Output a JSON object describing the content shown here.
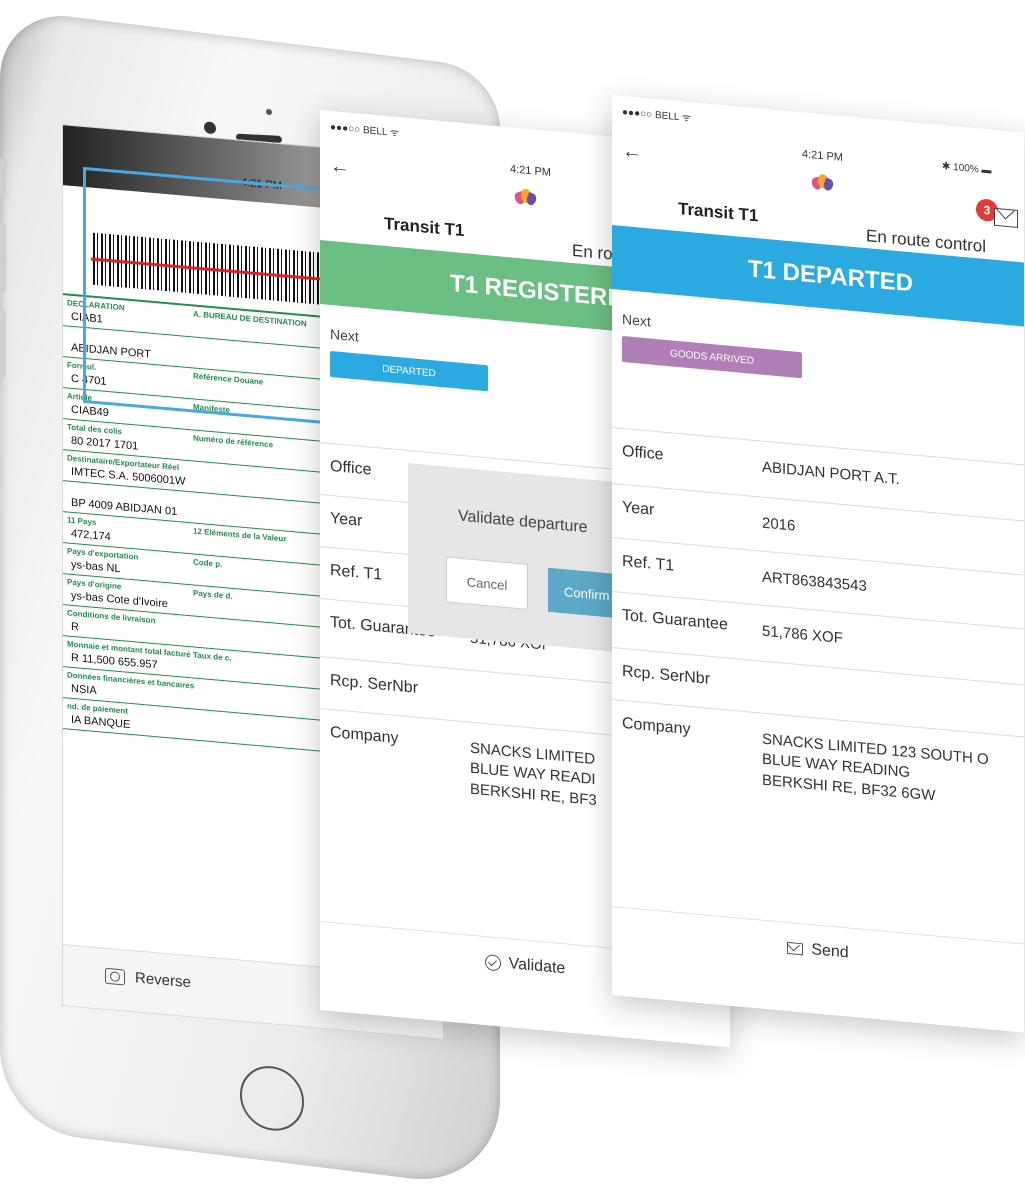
{
  "colors": {
    "registered_green": "#6cbf84",
    "departed_blue": "#2ba9e1",
    "next_departed_blue": "#2ba9e1",
    "goods_arrived_purple": "#b07fb8",
    "confirm_blue": "#5ba8c8",
    "badge_red": "#e53935"
  },
  "scan_screen": {
    "time": "4:21 PM",
    "doc_rows": [
      {
        "label": "DECLARATION",
        "label2": "A. BUREAU DE DESTINATION",
        "value": "CIAB1"
      },
      {
        "label": "",
        "label2": "",
        "value": "ABIDJAN PORT"
      },
      {
        "label": "Formul.",
        "label2": "Référence Douane",
        "value": "C   4701"
      },
      {
        "label": "Article",
        "label2": "Manifeste",
        "value": "CIAB49"
      },
      {
        "label": "Total des colis",
        "label2": "Numéro de référence",
        "value": "80   2017   1701"
      },
      {
        "label": "Destinataire/Exportateur Réel",
        "label2": "",
        "value": "IMTEC S.A.   5006001W"
      },
      {
        "label": "",
        "label2": "",
        "value": "BP 4009 ABIDJAN 01"
      },
      {
        "label": "11 Pays",
        "label2": "12 Eléments de la Valeur",
        "value": "472,174"
      },
      {
        "label": "Pays d'exportation",
        "label2": "Code p.",
        "value": "ys-bas   NL"
      },
      {
        "label": "Pays d'origine",
        "label2": "Pays de d.",
        "value": "ys-bas   Cote d'Ivoire"
      },
      {
        "label": "Conditions de livraison",
        "label2": "",
        "value": "R"
      },
      {
        "label": "Monnaie et montant total facturé",
        "label2": "Taux de c.",
        "value": "R   11,500   655.957"
      },
      {
        "label": "Données financières et bancaires",
        "label2": "",
        "value": "NSIA"
      },
      {
        "label": "nd. de paiement",
        "label2": "",
        "value": "IA BANQUE"
      }
    ],
    "reverse_label": "Reverse"
  },
  "screen1": {
    "carrier": "●●●○○ BELL ᯤ",
    "time": "4:21 PM",
    "transit_title": "Transit T1",
    "control_label": "En route control",
    "status_banner": "T1 REGISTERED",
    "next_label": "Next",
    "next_action": "DEPARTED",
    "details": [
      {
        "key": "Office",
        "value": ""
      },
      {
        "key": "Year",
        "value": ""
      },
      {
        "key": "Ref. T1",
        "value": ""
      },
      {
        "key": "Tot. Guarantee",
        "value": "51,786 XOF"
      },
      {
        "key": "Rcp. SerNbr",
        "value": ""
      },
      {
        "key": "Company",
        "value": "SNACKS LIMITED\nBLUE WAY READI\nBERKSHI RE, BF3"
      }
    ],
    "modal": {
      "text": "Validate departure",
      "cancel": "Cancel",
      "confirm": "Confirm"
    },
    "footer_label": "Validate"
  },
  "screen2": {
    "carrier": "●●●○○ BELL ᯤ",
    "time": "4:21 PM",
    "battery": "✱ 100% ▬",
    "notification_count": "3",
    "transit_title": "Transit T1",
    "control_label": "En route control",
    "status_banner": "T1 DEPARTED",
    "next_label": "Next",
    "next_action": "GOODS ARRIVED",
    "details": [
      {
        "key": "Office",
        "value": "ABIDJAN PORT A.T."
      },
      {
        "key": "Year",
        "value": "2016"
      },
      {
        "key": "Ref. T1",
        "value": "ART863843543"
      },
      {
        "key": "Tot. Guarantee",
        "value": "51,786 XOF"
      },
      {
        "key": "Rcp. SerNbr",
        "value": ""
      },
      {
        "key": "Company",
        "value": "SNACKS LIMITED 123 SOUTH O\nBLUE WAY READING\nBERKSHI RE, BF32 6GW"
      }
    ],
    "footer_label": "Send"
  }
}
